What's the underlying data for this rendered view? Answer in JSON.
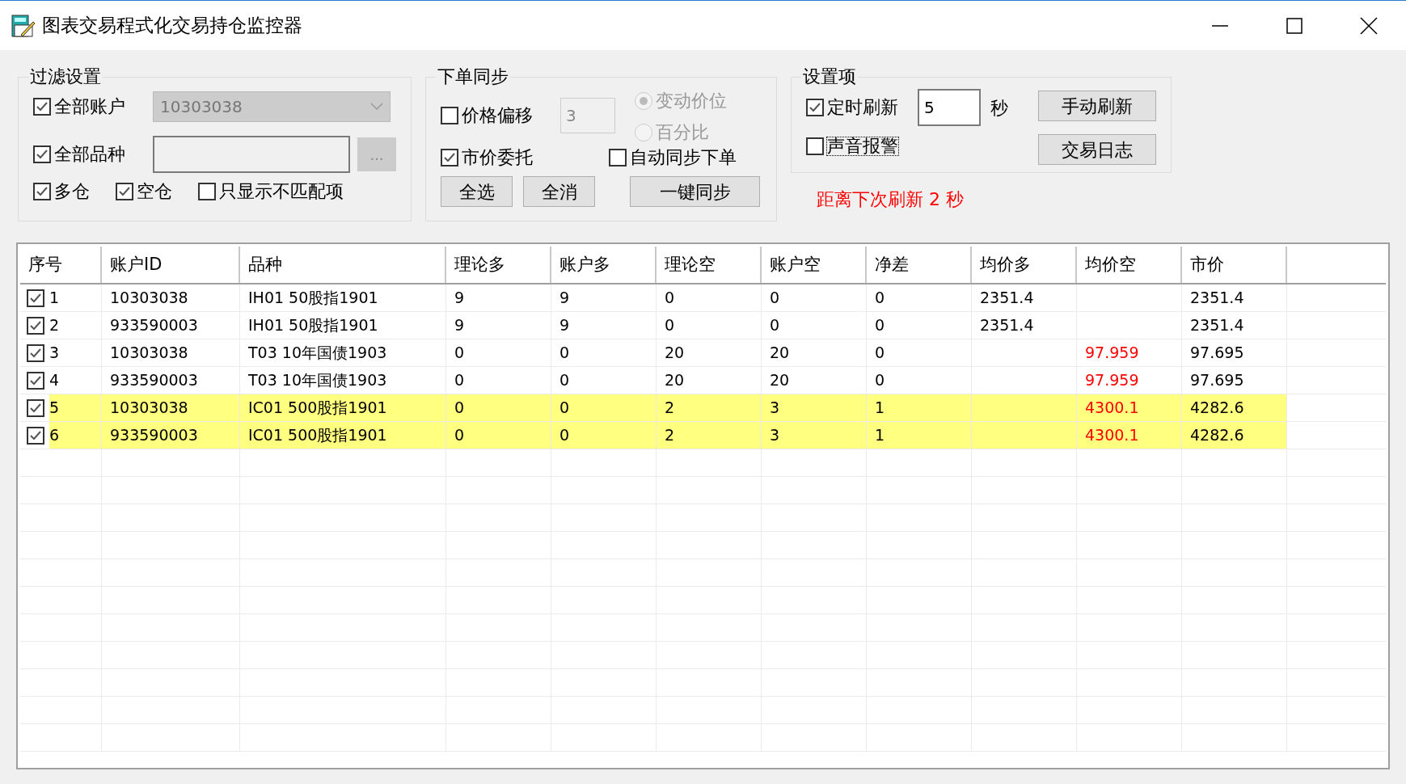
{
  "window": {
    "title": "图表交易程式化交易持仓监控器"
  },
  "filter": {
    "title": "过滤设置",
    "all_accounts": {
      "label": "全部账户",
      "checked": true
    },
    "account_select": {
      "value": "10303038",
      "disabled": true
    },
    "all_products": {
      "label": "全部品种",
      "checked": true
    },
    "browse_button": {
      "label": "...",
      "disabled": true
    },
    "options": [
      {
        "label": "多仓",
        "checked": true
      },
      {
        "label": "空仓",
        "checked": true
      },
      {
        "label": "只显示不匹配项",
        "checked": false
      }
    ]
  },
  "order_sync": {
    "title": "下单同步",
    "price_offset": {
      "label": "价格偏移",
      "checked": false
    },
    "offset_value": "3",
    "radios": [
      {
        "label": "变动价位",
        "selected": true,
        "disabled": true
      },
      {
        "label": "百分比",
        "selected": false,
        "disabled": true
      }
    ],
    "market_order": {
      "label": "市价委托",
      "checked": true
    },
    "auto_sync": {
      "label": "自动同步下单",
      "checked": false
    },
    "buttons": [
      "全选",
      "全消"
    ],
    "sync_button": "一键同步"
  },
  "settings": {
    "title": "设置项",
    "timed_refresh": {
      "label": "定时刷新",
      "checked": true
    },
    "interval": "5",
    "unit": "秒",
    "sound_alarm": {
      "label": "声音报警",
      "checked": false,
      "focused": true
    },
    "buttons": [
      "手动刷新",
      "交易日志"
    ]
  },
  "countdown": "距离下次刷新 2 秒",
  "table": {
    "columns": [
      "序号",
      "账户ID",
      "品种",
      "理论多",
      "账户多",
      "理论空",
      "账户空",
      "净差",
      "均价多",
      "均价空",
      "市价"
    ],
    "rows": [
      {
        "checked": true,
        "highlighted": false,
        "cells": [
          "1",
          "10303038",
          "IH01 50股指1901",
          "9",
          "9",
          "0",
          "0",
          "0",
          "2351.4",
          null,
          "2351.4"
        ]
      },
      {
        "checked": true,
        "highlighted": false,
        "cells": [
          "2",
          "933590003",
          "IH01 50股指1901",
          "9",
          "9",
          "0",
          "0",
          "0",
          "2351.4",
          null,
          "2351.4"
        ]
      },
      {
        "checked": true,
        "highlighted": false,
        "cells": [
          "3",
          "10303038",
          "T03 10年国债1903",
          "0",
          "0",
          "20",
          "20",
          "0",
          null,
          {
            "text": "97.959",
            "alert": true
          },
          "97.695"
        ]
      },
      {
        "checked": true,
        "highlighted": false,
        "cells": [
          "4",
          "933590003",
          "T03 10年国债1903",
          "0",
          "0",
          "20",
          "20",
          "0",
          null,
          {
            "text": "97.959",
            "alert": true
          },
          "97.695"
        ]
      },
      {
        "checked": true,
        "highlighted": true,
        "cells": [
          "5",
          "10303038",
          "IC01 500股指1901",
          "0",
          "0",
          "2",
          "3",
          "1",
          null,
          {
            "text": "4300.1",
            "alert": true
          },
          "4282.6"
        ]
      },
      {
        "checked": true,
        "highlighted": true,
        "cells": [
          "6",
          "933590003",
          "IC01 500股指1901",
          "0",
          "0",
          "2",
          "3",
          "1",
          null,
          {
            "text": "4300.1",
            "alert": true
          },
          "4282.6"
        ]
      }
    ]
  }
}
